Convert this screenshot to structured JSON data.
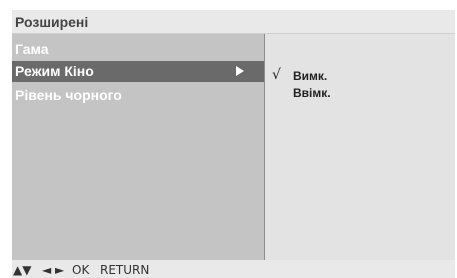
{
  "menu": {
    "title": "Розширені",
    "items": [
      {
        "label": "Гама",
        "selected": false
      },
      {
        "label": "Режим Кіно",
        "selected": true
      },
      {
        "label": "Рівень чорного",
        "selected": false
      }
    ],
    "submenu_arrow_icon": "triangle-right-icon"
  },
  "options": {
    "check_mark": "√",
    "items": [
      {
        "label": "Вимк.",
        "checked": true
      },
      {
        "label": "Ввімк.",
        "checked": false
      }
    ]
  },
  "footer": {
    "updown": "▲▼",
    "leftright": "◄ ►",
    "ok": "OK",
    "return": "RETURN"
  },
  "colors": {
    "panel_left": "#c4c4c4",
    "panel_right": "#e3e3e3",
    "highlight": "#6a6a6a",
    "title_bar": "#e9e9e9"
  }
}
